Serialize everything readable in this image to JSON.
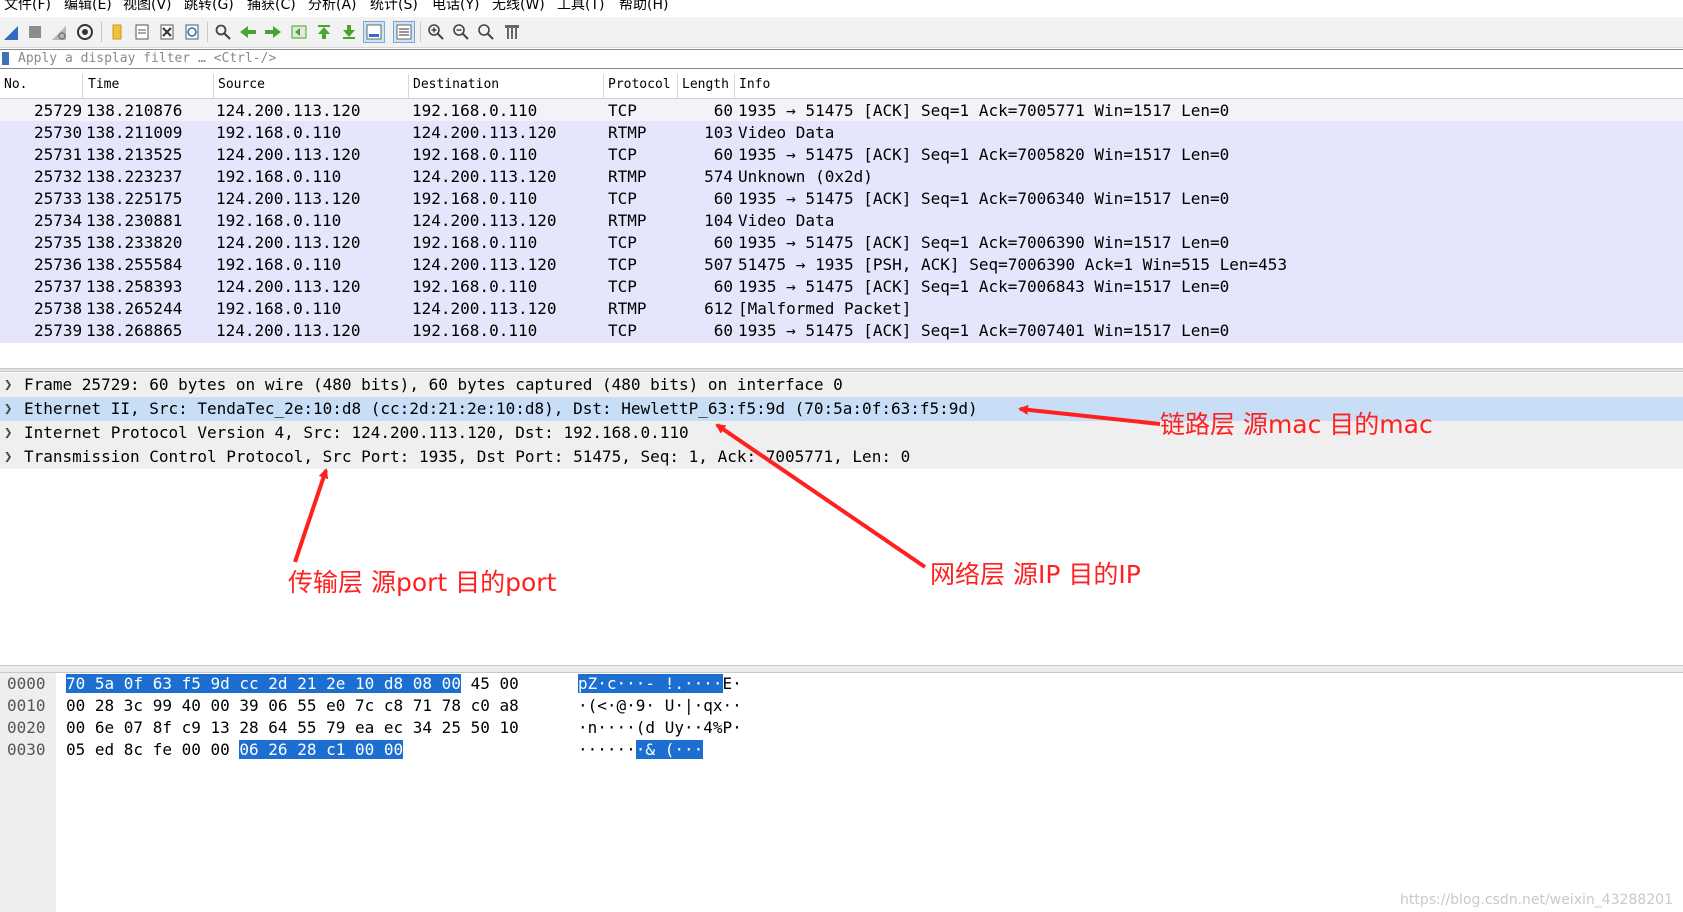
{
  "menu": [
    "文件(F)",
    "编辑(E)",
    "视图(V)",
    "跳转(G)",
    "捕获(C)",
    "分析(A)",
    "统计(S)",
    "电话(Y)",
    "无线(W)",
    "工具(T)",
    "帮助(H)"
  ],
  "filter": {
    "placeholder": "Apply a display filter … <Ctrl-/>"
  },
  "columns": {
    "no": "No.",
    "time": "Time",
    "source": "Source",
    "destination": "Destination",
    "protocol": "Protocol",
    "length": "Length",
    "info": "Info"
  },
  "packets": [
    {
      "no": "25729",
      "time": "138.210876",
      "src": "124.200.113.120",
      "dst": "192.168.0.110",
      "proto": "TCP",
      "len": "60",
      "info": "1935 → 51475 [ACK] Seq=1 Ack=7005771 Win=1517 Len=0"
    },
    {
      "no": "25730",
      "time": "138.211009",
      "src": "192.168.0.110",
      "dst": "124.200.113.120",
      "proto": "RTMP",
      "len": "103",
      "info": "Video Data"
    },
    {
      "no": "25731",
      "time": "138.213525",
      "src": "124.200.113.120",
      "dst": "192.168.0.110",
      "proto": "TCP",
      "len": "60",
      "info": "1935 → 51475 [ACK] Seq=1 Ack=7005820 Win=1517 Len=0"
    },
    {
      "no": "25732",
      "time": "138.223237",
      "src": "192.168.0.110",
      "dst": "124.200.113.120",
      "proto": "RTMP",
      "len": "574",
      "info": "Unknown (0x2d)"
    },
    {
      "no": "25733",
      "time": "138.225175",
      "src": "124.200.113.120",
      "dst": "192.168.0.110",
      "proto": "TCP",
      "len": "60",
      "info": "1935 → 51475 [ACK] Seq=1 Ack=7006340 Win=1517 Len=0"
    },
    {
      "no": "25734",
      "time": "138.230881",
      "src": "192.168.0.110",
      "dst": "124.200.113.120",
      "proto": "RTMP",
      "len": "104",
      "info": "Video Data"
    },
    {
      "no": "25735",
      "time": "138.233820",
      "src": "124.200.113.120",
      "dst": "192.168.0.110",
      "proto": "TCP",
      "len": "60",
      "info": "1935 → 51475 [ACK] Seq=1 Ack=7006390 Win=1517 Len=0"
    },
    {
      "no": "25736",
      "time": "138.255584",
      "src": "192.168.0.110",
      "dst": "124.200.113.120",
      "proto": "TCP",
      "len": "507",
      "info": "51475 → 1935 [PSH, ACK] Seq=7006390 Ack=1 Win=515 Len=453"
    },
    {
      "no": "25737",
      "time": "138.258393",
      "src": "124.200.113.120",
      "dst": "192.168.0.110",
      "proto": "TCP",
      "len": "60",
      "info": "1935 → 51475 [ACK] Seq=1 Ack=7006843 Win=1517 Len=0"
    },
    {
      "no": "25738",
      "time": "138.265244",
      "src": "192.168.0.110",
      "dst": "124.200.113.120",
      "proto": "RTMP",
      "len": "612",
      "info": "[Malformed Packet]"
    },
    {
      "no": "25739",
      "time": "138.268865",
      "src": "124.200.113.120",
      "dst": "192.168.0.110",
      "proto": "TCP",
      "len": "60",
      "info": "1935 → 51475 [ACK] Seq=1 Ack=7007401 Win=1517 Len=0"
    }
  ],
  "details": [
    "Frame 25729: 60 bytes on wire (480 bits), 60 bytes captured (480 bits) on interface 0",
    "Ethernet II, Src: TendaTec_2e:10:d8 (cc:2d:21:2e:10:d8), Dst: HewlettP_63:f5:9d (70:5a:0f:63:f5:9d)",
    "Internet Protocol Version 4, Src: 124.200.113.120, Dst: 192.168.0.110",
    "Transmission Control Protocol, Src Port: 1935, Dst Port: 51475, Seq: 1, Ack: 7005771, Len: 0"
  ],
  "bytes": [
    {
      "offset": "0000",
      "hex_hl_pre": "",
      "hex_hl": "70 5a 0f 63 f5 9d cc 2d  21 2e 10 d8 08 00",
      "hex_rest": " 45 00",
      "ascii_hl_pre": "",
      "ascii_hl": "pZ·c···- !.····",
      "ascii_rest": "E·"
    },
    {
      "offset": "0010",
      "hex_hl_pre": "00 28 3c 99 40 00 39 06  55 e0 7c c8 71 78 c0 a8",
      "hex_hl": "",
      "hex_rest": "",
      "ascii_hl_pre": "·(<·@·9· U·|·qx··",
      "ascii_hl": "",
      "ascii_rest": ""
    },
    {
      "offset": "0020",
      "hex_hl_pre": "00 6e 07 8f c9 13 28 64  55 79 ea ec 34 25 50 10",
      "hex_hl": "",
      "hex_rest": "",
      "ascii_hl_pre": "·n····(d Uy··4%P·",
      "ascii_hl": "",
      "ascii_rest": ""
    },
    {
      "offset": "0030",
      "hex_hl_pre": "05 ed 8c fe 00 00 ",
      "hex_hl": "06 26  28 c1 00 00",
      "hex_rest": "",
      "ascii_hl_pre": "······",
      "ascii_hl": "·& (···",
      "ascii_rest": ""
    }
  ],
  "annotations": {
    "link": "链路层 源mac 目的mac",
    "network": "网络层 源IP 目的IP",
    "transport": "传输层 源port  目的port"
  },
  "watermark": "https://blog.csdn.net/weixin_43288201",
  "colors": {
    "row_bg": "#e5e6fb",
    "selected_detail": "#c8def7",
    "byte_highlight": "#1c6fd1",
    "annotation": "#ff2020"
  }
}
